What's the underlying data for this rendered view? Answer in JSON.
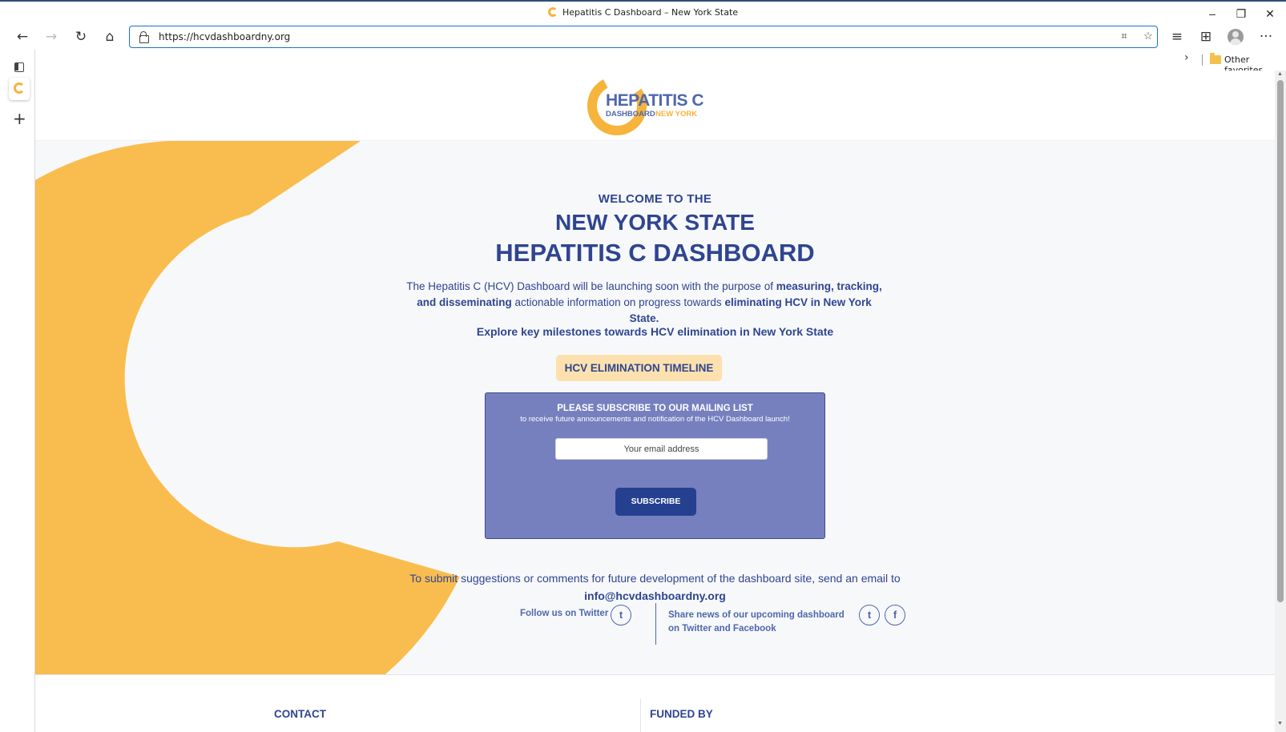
{
  "window": {
    "title": "Hepatitis C Dashboard – New York State",
    "minimize_glyph": "–",
    "restore_glyph": "❐",
    "close_glyph": "✕"
  },
  "toolbar": {
    "back_glyph": "←",
    "forward_glyph": "→",
    "refresh_glyph": "↻",
    "home_glyph": "⌂",
    "url": "https://hcvdashboardny.org",
    "qr_glyph": "⌗",
    "add_fav_glyph": "☆",
    "favorites_glyph": "≡",
    "collections_glyph": "⊞",
    "more_glyph": "···"
  },
  "favorites_bar": {
    "chevron_glyph": "›",
    "other_favorites": "Other favorites"
  },
  "sidebar": {
    "plus_glyph": "+"
  },
  "logo": {
    "line1": "HEPATITIS C",
    "line2a": "DASHBOARD",
    "line2b": "NEW YORK"
  },
  "hero": {
    "welcome": "WELCOME TO THE",
    "headline1": "NEW YORK STATE",
    "headline2": "HEPATITIS C DASHBOARD",
    "intro_1": "The Hepatitis C (HCV) Dashboard will be launching soon with the purpose of ",
    "intro_bold1": "measuring, tracking, and disseminating",
    "intro_2": " actionable information on progress towards ",
    "intro_bold2": "eliminating HCV in New York State.",
    "explore": "Explore key milestones towards HCV elimination in New York State",
    "timeline_button": "HCV ELIMINATION TIMELINE"
  },
  "subscribe": {
    "heading": "PLEASE SUBSCRIBE TO OUR MAILING LIST",
    "subheading": "to receive future announcements and notification of the HCV Dashboard launch!",
    "email_placeholder": "Your email address",
    "button": "SUBSCRIBE"
  },
  "contact": {
    "suggest": "To submit suggestions or comments for future development of the dashboard site, send an email to",
    "email": "info@hcvdashboardny.org",
    "follow": "Follow us on Twitter",
    "share": "Share news of our upcoming dashboard on Twitter and Facebook",
    "twitter_glyph": "t",
    "facebook_glyph": "f"
  },
  "footer": {
    "contact_heading": "CONTACT",
    "funded_heading": "FUNDED BY"
  },
  "colors": {
    "brand_blue": "#2f4590",
    "brand_yellow": "#f6b43c",
    "subscribe_bg": "#7680bf",
    "timeline_bg": "#fce1ae"
  }
}
